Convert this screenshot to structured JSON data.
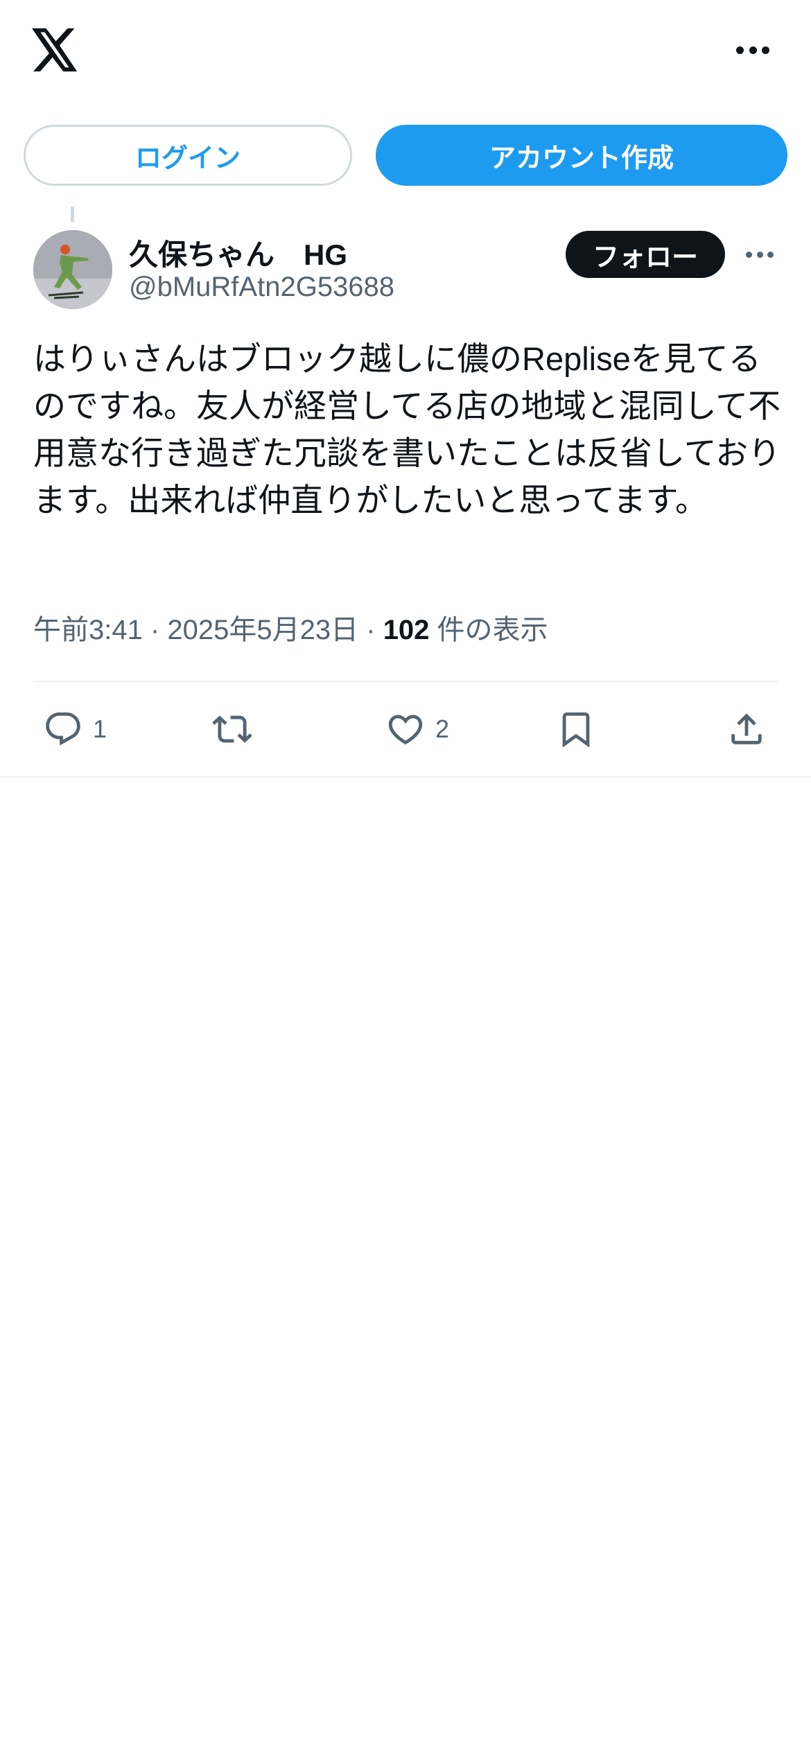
{
  "header": {
    "logo_icon": "x-logo-icon",
    "more_icon": "more-horizontal-icon"
  },
  "auth": {
    "login_label": "ログイン",
    "signup_label": "アカウント作成"
  },
  "post": {
    "author_name": "久保ちゃん　HG",
    "author_handle": "@bMuRfAtn2G53688",
    "follow_label": "フォロー",
    "text": "はりぃさんはブロック越しに儂のRepliseを見てるのですね。友人が経営してる店の地域と混同して不用意な行き過ぎた冗談を書いたことは反省しております。出来れば仲直りがしたいと思ってます。",
    "time": "午前3:41",
    "date": "2025年5月23日",
    "separator": " · ",
    "views_count": "102",
    "views_label": " 件の表示"
  },
  "actions": {
    "reply_count": "1",
    "repost_count": "",
    "like_count": "2"
  },
  "colors": {
    "accent": "#1d9bf0",
    "text": "#0f1419",
    "muted": "#536471",
    "border": "#cfd9de",
    "divider": "#eff3f4"
  }
}
